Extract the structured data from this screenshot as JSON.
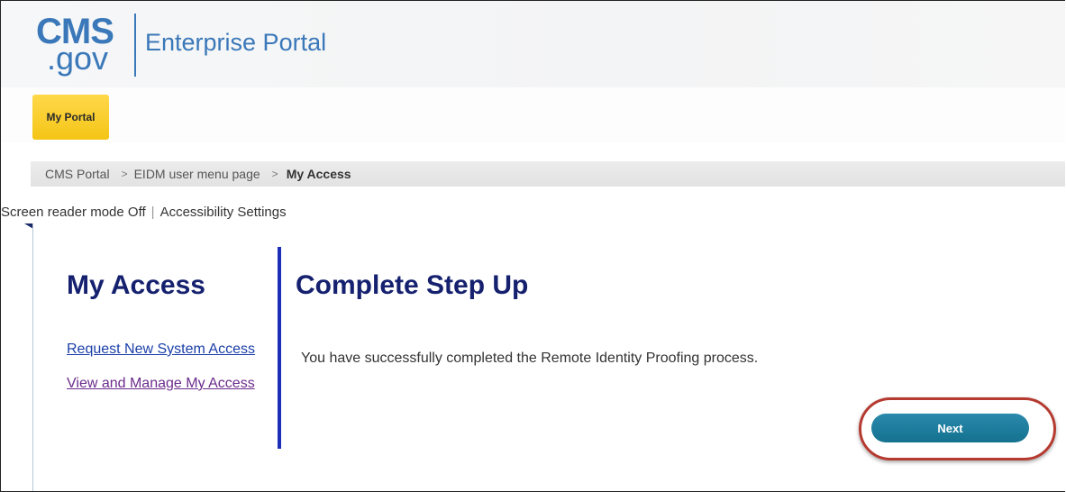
{
  "header": {
    "logo_cms": "CMS",
    "logo_gov": ".gov",
    "portal_name": "Enterprise Portal"
  },
  "nav": {
    "tab_label": "My Portal"
  },
  "breadcrumb": {
    "items": [
      "CMS Portal",
      "EIDM user menu page"
    ],
    "separator": ">",
    "current": "My Access"
  },
  "accessibility": {
    "screen_reader": "Screen reader mode Off",
    "divider": "|",
    "settings": "Accessibility Settings"
  },
  "sidebar": {
    "title": "My Access",
    "links": [
      {
        "label": "Request New System Access"
      },
      {
        "label": "View and Manage My Access"
      }
    ]
  },
  "main": {
    "title": "Complete Step Up",
    "message": "You have successfully completed the Remote Identity Proofing process.",
    "next_label": "Next"
  },
  "colors": {
    "brand_blue": "#3a78b9",
    "heading_navy": "#15216f",
    "tab_yellow": "#f4c516",
    "button_teal": "#14718f",
    "highlight_red": "#b53a30"
  }
}
